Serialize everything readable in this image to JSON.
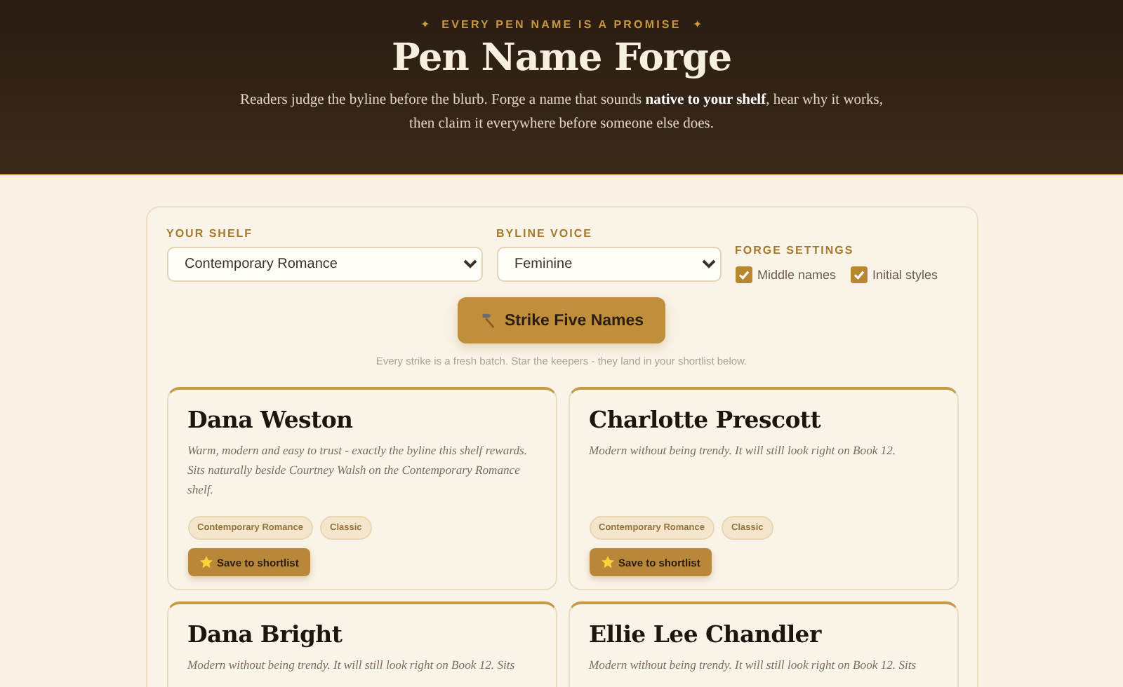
{
  "hero": {
    "eyebrow": "EVERY PEN NAME IS A PROMISE",
    "eyebrow_mark": "✦",
    "title": "Pen Name Forge",
    "lead": "Readers judge the byline before the blurb. Forge a name that sounds **native to your shelf**, hear why it works, then claim it everywhere before someone else does."
  },
  "form": {
    "shelf": {
      "label": "YOUR SHELF",
      "value": "Contemporary Romance"
    },
    "voice": {
      "label": "BYLINE VOICE",
      "value": "Feminine"
    },
    "settings": {
      "label": "FORGE SETTINGS",
      "options": [
        {
          "label": "Middle names",
          "checked": true
        },
        {
          "label": "Initial styles",
          "checked": true
        }
      ]
    },
    "button": "Strike Five Names",
    "hint": "Every strike is a fresh batch. Star the keepers - they land in your shortlist below."
  },
  "cards": [
    {
      "name": "Dana Weston",
      "description": "Warm, modern and easy to trust - exactly the byline this shelf rewards. Sits naturally beside Courtney Walsh on the Contemporary Romance shelf.",
      "tags": [
        "Contemporary Romance",
        "Classic"
      ],
      "button": "Save to shortlist"
    },
    {
      "name": "Charlotte Prescott",
      "description": "Modern without being trendy. It will still look right on Book 12.",
      "tags": [
        "Contemporary Romance",
        "Classic"
      ],
      "button": "Save to shortlist"
    },
    {
      "name": "Dana Bright",
      "description": "Modern without being trendy. It will still look right on Book 12. Sits"
    },
    {
      "name": "Ellie Lee Chandler",
      "description": "Modern without being trendy. It will still look right on Book 12. Sits"
    }
  ]
}
